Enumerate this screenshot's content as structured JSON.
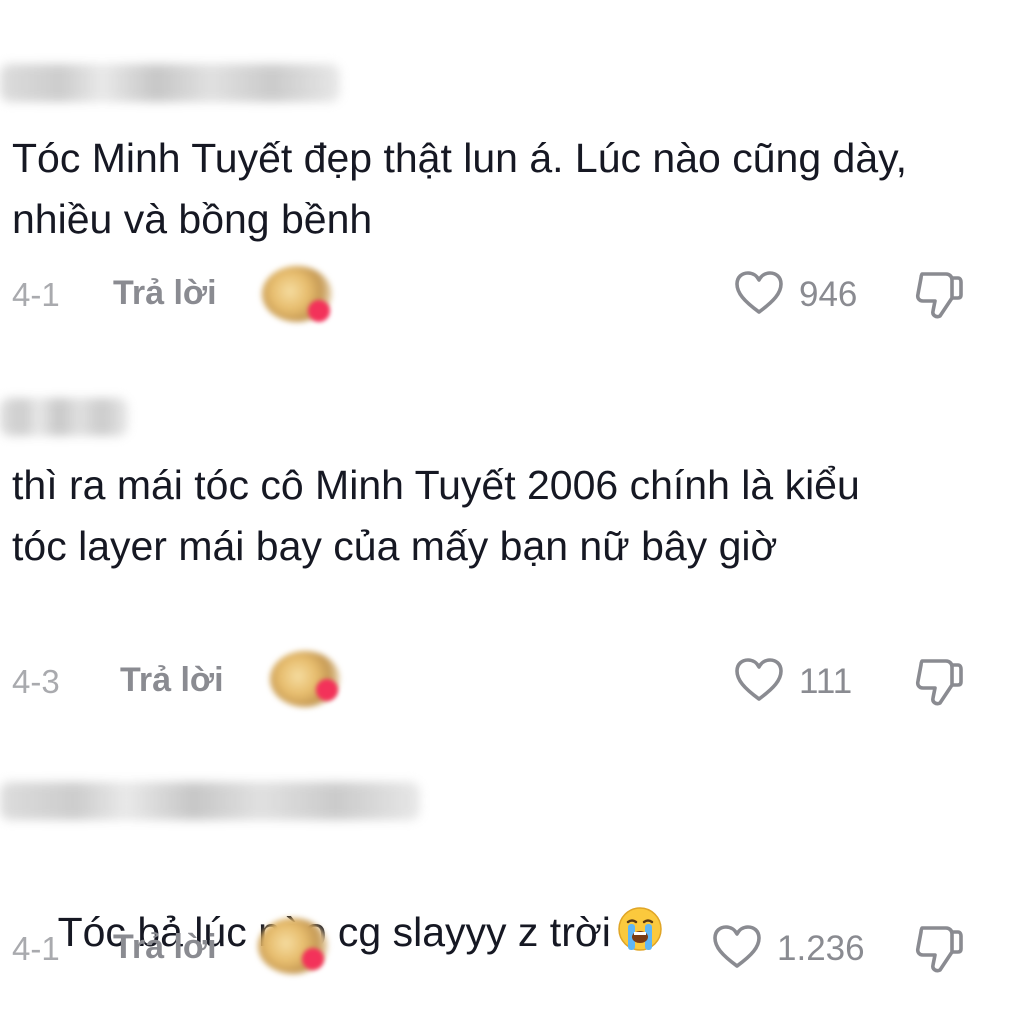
{
  "comments": [
    {
      "text": "Tóc Minh Tuyết đẹp thật lun á. Lúc nào cũng dày, nhiều và bồng bềnh",
      "date": "4-1",
      "reply_label": "Trả lời",
      "likes": "946"
    },
    {
      "text": "thì ra mái tóc cô Minh Tuyết 2006 chính là kiểu tóc layer mái bay của mấy bạn nữ bây giờ",
      "date": "4-3",
      "reply_label": "Trả lời",
      "likes": "111"
    },
    {
      "text": "Tóc bả lúc nào cg slayyy z trời",
      "emoji": "loudly-crying-face",
      "date": "4-1",
      "reply_label": "Trả lời",
      "likes": "1.236"
    }
  ],
  "icons": {
    "like": "heart-outline-icon",
    "dislike": "thumbs-down-outline-icon"
  },
  "colors": {
    "text": "#161823",
    "secondary": "#8a8b91",
    "date": "#a9aaae"
  }
}
